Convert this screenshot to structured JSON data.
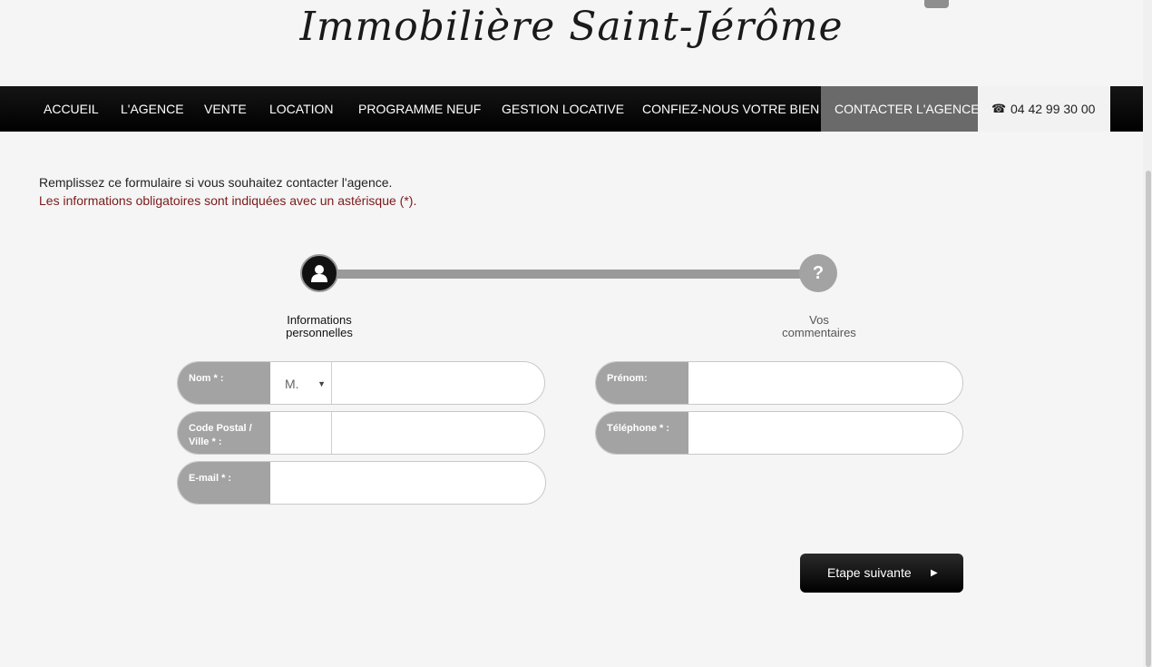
{
  "logo": "Immobilière Saint-Jérôme",
  "nav": {
    "items": [
      "ACCUEIL",
      "L'AGENCE",
      "VENTE",
      "LOCATION",
      "PROGRAMME NEUF",
      "GESTION LOCATIVE",
      "CONFIEZ-NOUS VOTRE BIEN",
      "CONTACTER L'AGENCE"
    ],
    "active": "CONTACTER L'AGENCE",
    "phone": "04 42 99 30 00",
    "phone_icon": "phone-icon"
  },
  "intro": {
    "line1": "Remplissez ce formulaire si vous souhaitez contacter l'agence.",
    "line2": "Les informations obligatoires sont indiquées avec un astérisque (*)."
  },
  "steps": [
    {
      "line1": "Informations",
      "line2": "personnelles",
      "icon": "user-icon",
      "state": "active"
    },
    {
      "line1": "Vos",
      "line2": "commentaires",
      "icon": "question-icon",
      "state": "inactive"
    }
  ],
  "form": {
    "nom_label": "Nom * :",
    "civilite_value": "M.",
    "prenom_label": "Prénom:",
    "cp_label_1": "Code Postal /",
    "cp_label_2": "Ville * :",
    "tel_label": "Téléphone * :",
    "email_label": "E-mail * :"
  },
  "next_button": "Etape suivante",
  "colors": {
    "nav_bg": "#000000",
    "nav_active": "#6a6a6a",
    "label_bg": "#a3a3a3",
    "required_text": "#7a1a1a"
  }
}
